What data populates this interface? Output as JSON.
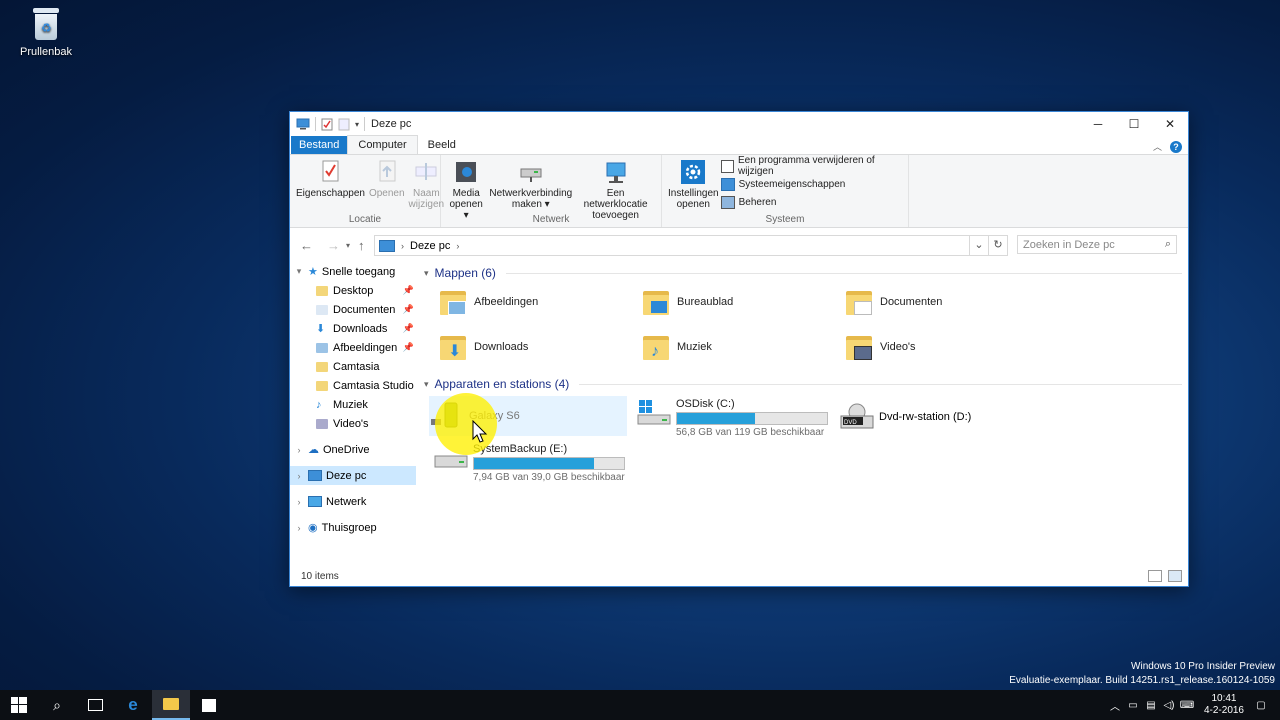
{
  "desktop": {
    "recycle_bin_label": "Prullenbak"
  },
  "window": {
    "title": "Deze pc",
    "controls": {
      "minimize": "─",
      "maximize": "☐",
      "close": "✕"
    }
  },
  "tabs": {
    "file": "Bestand",
    "computer": "Computer",
    "view": "Beeld"
  },
  "ribbon": {
    "location_group": {
      "label": "Locatie",
      "properties": "Eigenschappen",
      "open": "Openen",
      "rename_1": "Naam",
      "rename_2": "wijzigen"
    },
    "network_group": {
      "label": "Netwerk",
      "media_1": "Media",
      "media_2": "openen ▾",
      "mapdrive_1": "Netwerkverbinding",
      "mapdrive_2": "maken ▾",
      "addloc_1": "Een netwerklocatie",
      "addloc_2": "toevoegen"
    },
    "system_group": {
      "label": "Systeem",
      "settings_1": "Instellingen",
      "settings_2": "openen",
      "uninstall": "Een programma verwijderen of wijzigen",
      "sysprops": "Systeemeigenschappen",
      "manage": "Beheren"
    }
  },
  "address": {
    "path": "Deze pc",
    "search_placeholder": "Zoeken in Deze pc"
  },
  "nav": {
    "quick_access": "Snelle toegang",
    "items": [
      "Desktop",
      "Documenten",
      "Downloads",
      "Afbeeldingen",
      "Camtasia",
      "Camtasia Studio",
      "Muziek",
      "Video's"
    ],
    "onedrive": "OneDrive",
    "thispc": "Deze pc",
    "network": "Netwerk",
    "homegroup": "Thuisgroep"
  },
  "folders": {
    "header": "Mappen (6)",
    "items": [
      "Afbeeldingen",
      "Bureaublad",
      "Documenten",
      "Downloads",
      "Muziek",
      "Video's"
    ]
  },
  "devices": {
    "header": "Apparaten en stations (4)",
    "galaxy": {
      "name": "Galaxy S6"
    },
    "osdisk": {
      "name": "OSDisk (C:)",
      "free": "56,8 GB van 119 GB beschikbaar",
      "used_fraction": 0.52
    },
    "dvd": {
      "name": "Dvd-rw-station (D:)",
      "badge": "DVD"
    },
    "backup": {
      "name": "SystemBackup (E:)",
      "free": "7,94 GB van 39,0 GB beschikbaar",
      "used_fraction": 0.8
    }
  },
  "status": {
    "count": "10 items"
  },
  "watermark": {
    "line1": "Windows 10 Pro Insider Preview",
    "line2": "Evaluatie-exemplaar. Build 14251.rs1_release.160124-1059"
  },
  "clock": {
    "time": "10:41",
    "date": "4-2-2016"
  }
}
